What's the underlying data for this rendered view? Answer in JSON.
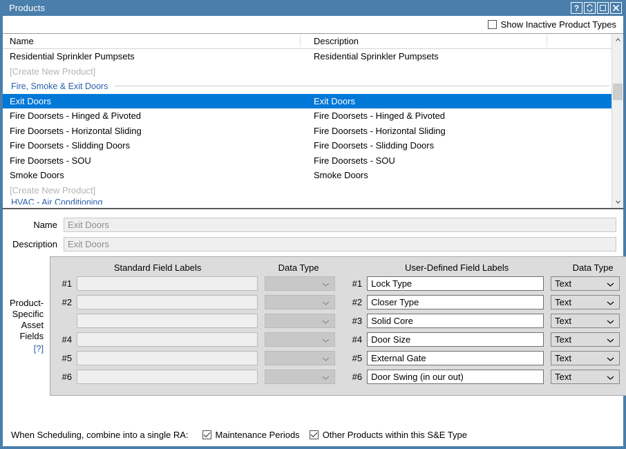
{
  "window": {
    "title": "Products",
    "buttons": [
      {
        "name": "help-button",
        "label": "?"
      },
      {
        "name": "refresh-button",
        "label": ""
      },
      {
        "name": "maximize-button",
        "label": ""
      },
      {
        "name": "close-button",
        "label": ""
      }
    ]
  },
  "toolbar": {
    "show_inactive_label": "Show Inactive Product Types",
    "show_inactive_checked": false
  },
  "grid": {
    "columns": [
      "Name",
      "Description"
    ],
    "rows": [
      {
        "type": "item",
        "name": "Residential Sprinkler Pumpsets",
        "description": "Residential Sprinkler Pumpsets",
        "dim": false,
        "selected": false
      },
      {
        "type": "item",
        "name": "[Create New Product]",
        "description": "",
        "dim": true,
        "selected": false
      },
      {
        "type": "group",
        "name": "Fire, Smoke & Exit Doors",
        "description": ""
      },
      {
        "type": "item",
        "name": "Exit Doors",
        "description": "Exit Doors",
        "dim": false,
        "selected": true
      },
      {
        "type": "item",
        "name": "Fire Doorsets - Hinged & Pivoted",
        "description": "Fire Doorsets - Hinged & Pivoted",
        "dim": false,
        "selected": false
      },
      {
        "type": "item",
        "name": "Fire Doorsets - Horizontal Sliding",
        "description": "Fire Doorsets - Horizontal Sliding",
        "dim": false,
        "selected": false
      },
      {
        "type": "item",
        "name": "Fire Doorsets - Slidding Doors",
        "description": "Fire Doorsets - Slidding Doors",
        "dim": false,
        "selected": false
      },
      {
        "type": "item",
        "name": "Fire Doorsets - SOU",
        "description": "Fire Doorsets - SOU",
        "dim": false,
        "selected": false
      },
      {
        "type": "item",
        "name": "Smoke Doors",
        "description": "Smoke Doors",
        "dim": false,
        "selected": false
      },
      {
        "type": "item",
        "name": "[Create New Product]",
        "description": "",
        "dim": true,
        "selected": false
      },
      {
        "type": "clipped-group",
        "name": "HVAC - Air Conditioning",
        "description": ""
      }
    ]
  },
  "detail": {
    "name_label": "Name",
    "name_value": "Exit Doors",
    "description_label": "Description",
    "description_value": "Exit Doors",
    "side_label_lines": [
      "Product-",
      "Specific",
      "Asset",
      "Fields"
    ],
    "help_link": "[?]",
    "headers": {
      "standard": "Standard Field Labels",
      "data_type_left": "Data Type",
      "user_defined": "User-Defined Field Labels",
      "data_type_right": "Data Type"
    },
    "standard_fields": [
      {
        "num": "#1",
        "value": "",
        "data_type": ""
      },
      {
        "num": "#2",
        "value": "",
        "data_type": ""
      },
      {
        "num": "",
        "value": "",
        "data_type": ""
      },
      {
        "num": "#4",
        "value": "",
        "data_type": ""
      },
      {
        "num": "#5",
        "value": "",
        "data_type": ""
      },
      {
        "num": "#6",
        "value": "",
        "data_type": ""
      }
    ],
    "user_fields": [
      {
        "num": "#1",
        "value": "Lock Type",
        "data_type": "Text"
      },
      {
        "num": "#2",
        "value": "Closer Type",
        "data_type": "Text"
      },
      {
        "num": "#3",
        "value": "Solid Core",
        "data_type": "Text"
      },
      {
        "num": "#4",
        "value": "Door Size",
        "data_type": "Text"
      },
      {
        "num": "#5",
        "value": "External Gate",
        "data_type": "Text"
      },
      {
        "num": "#6",
        "value": "Door Swing (in our out)",
        "data_type": "Text"
      }
    ]
  },
  "footer": {
    "lead_label": "When Scheduling, combine into a single RA:",
    "maintenance_label": "Maintenance Periods",
    "maintenance_checked": true,
    "other_products_label": "Other Products within this S&E Type",
    "other_products_checked": true
  },
  "colors": {
    "frame": "#4a7eab",
    "selection": "#0078d7",
    "group_text": "#2a5faa",
    "panel": "#dcdcdc"
  }
}
